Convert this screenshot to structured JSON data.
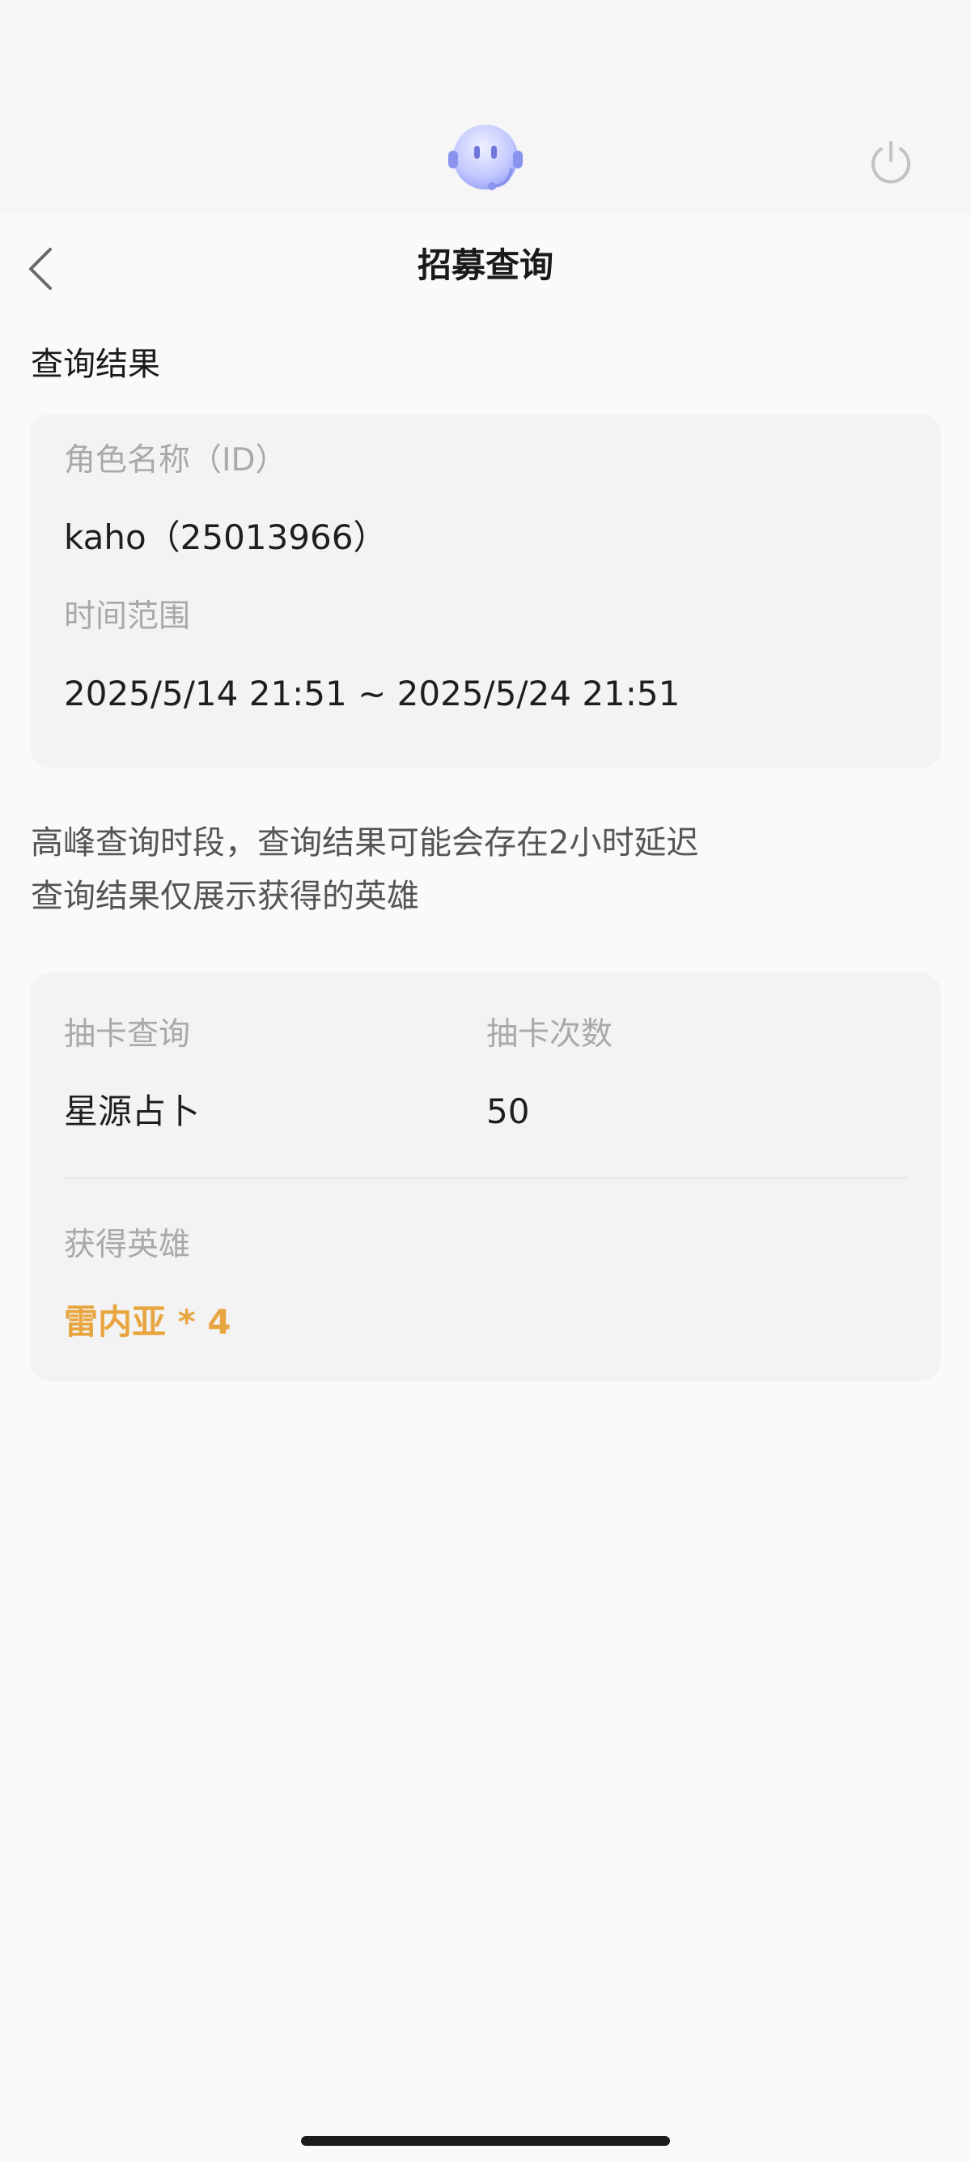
{
  "colors": {
    "accent": "#e8a641",
    "label": "#a9a9a9",
    "card_bg": "#f3f3f3",
    "avatar": "#b9c0ff"
  },
  "header": {
    "avatar_icon": "support-bot-avatar",
    "power_icon": "power-icon"
  },
  "nav": {
    "back_icon": "chevron-left-icon",
    "title": "招募查询"
  },
  "results": {
    "section_title": "查询结果",
    "role_label": "角色名称（ID）",
    "role_value": "kaho（25013966）",
    "time_label": "时间范围",
    "time_value": "2025/5/14 21:51 ~ 2025/5/24 21:51"
  },
  "notices": [
    "高峰查询时段，查询结果可能会存在2小时延迟",
    "查询结果仅展示获得的英雄"
  ],
  "draw": {
    "query_label": "抽卡查询",
    "query_value": "星源占卜",
    "count_label": "抽卡次数",
    "count_value": "50",
    "heroes_label": "获得英雄",
    "heroes_value": "雷内亚 * 4"
  }
}
